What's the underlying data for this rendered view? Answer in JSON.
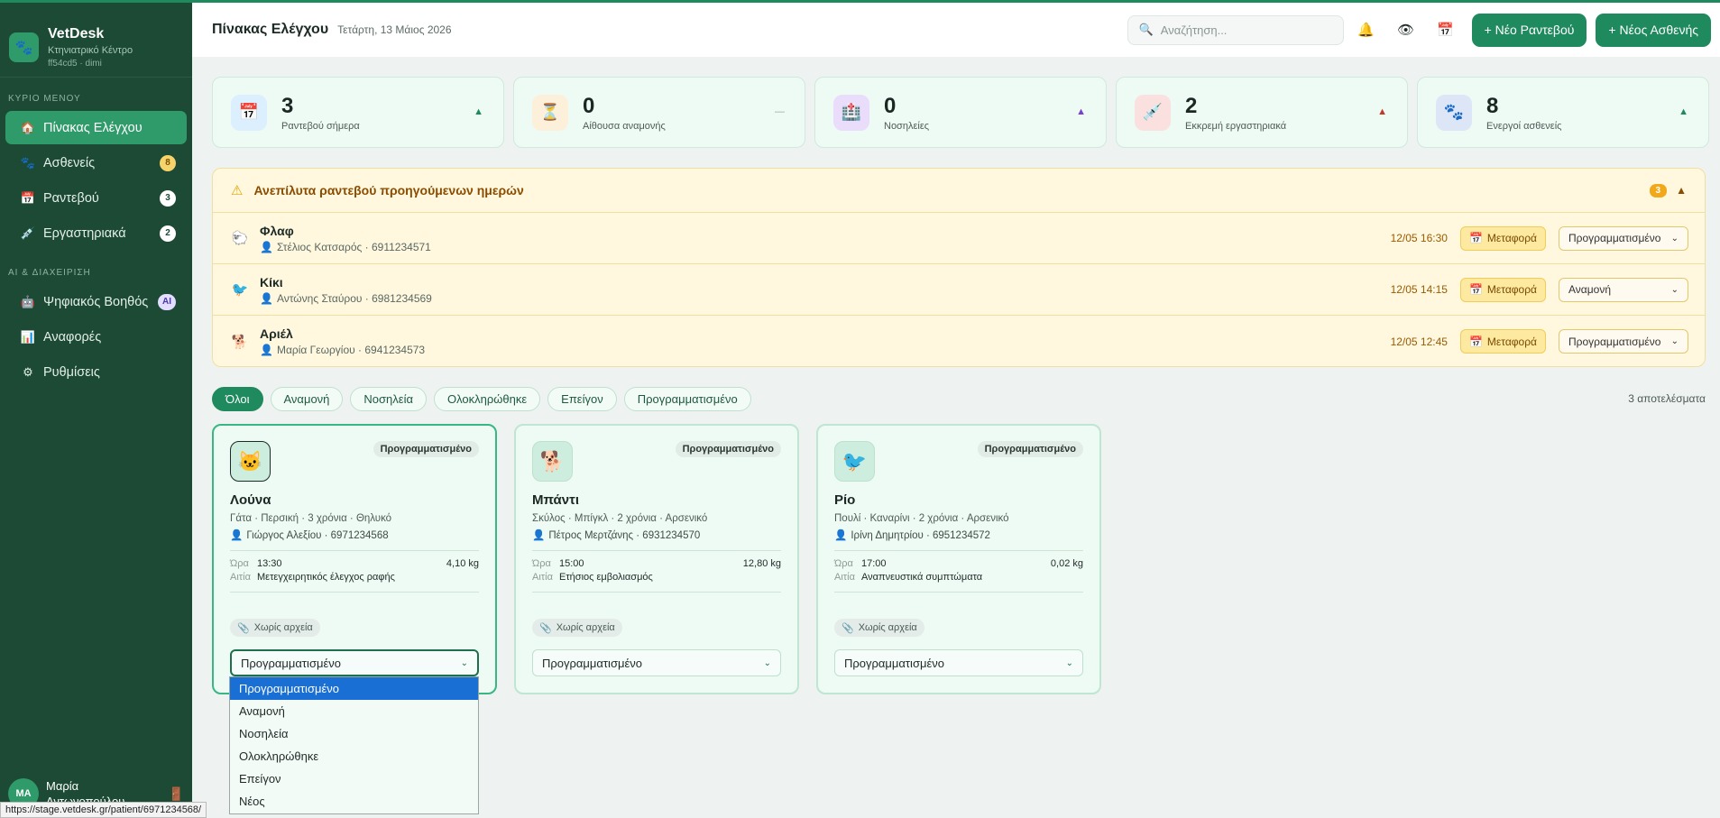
{
  "brand": {
    "name": "VetDesk",
    "subtitle": "Κτηνιατρικό Κέντρο",
    "version": "ff54cd5 · dimi"
  },
  "sidebar": {
    "section_main": "ΚΥΡΙΟ ΜΕΝΟΥ",
    "section_ai": "AI & ΔΙΑΧΕΙΡΙΣΗ",
    "items": [
      {
        "label": "Πίνακας Ελέγχου",
        "badge": ""
      },
      {
        "label": "Ασθενείς",
        "badge": "8"
      },
      {
        "label": "Ραντεβού",
        "badge": "3"
      },
      {
        "label": "Εργαστηριακά",
        "badge": "2"
      }
    ],
    "ai_items": [
      {
        "label": "Ψηφιακός Βοηθός",
        "badge": "AI"
      },
      {
        "label": "Αναφορές",
        "badge": ""
      },
      {
        "label": "Ρυθμίσεις",
        "badge": ""
      }
    ],
    "user": {
      "initials": "MA",
      "name": "Μαρία Αντωνοπούλου"
    }
  },
  "header": {
    "title": "Πίνακας Ελέγχου",
    "date": "Τετάρτη, 13 Μάιος 2026",
    "search_placeholder": "Αναζήτηση...",
    "new_appointment": "+ Νέο Ραντεβού",
    "new_patient": "+ Νέος Ασθενής"
  },
  "stats": [
    {
      "value": "3",
      "label": "Ραντεβού σήμερα",
      "icon": "calendar-icon",
      "trend": "▲",
      "color": "#1f8a5d"
    },
    {
      "value": "0",
      "label": "Αίθουσα αναμονής",
      "icon": "hourglass-icon",
      "trend": "—",
      "color": "#9aa59f"
    },
    {
      "value": "0",
      "label": "Νοσηλείες",
      "icon": "hospital-icon",
      "trend": "▲",
      "color": "#7b3fd0"
    },
    {
      "value": "2",
      "label": "Εκκρεμή εργαστηριακά",
      "icon": "syringe-icon",
      "trend": "▲",
      "color": "#c0392b"
    },
    {
      "value": "8",
      "label": "Ενεργοί ασθενείς",
      "icon": "paw-icon",
      "trend": "▲",
      "color": "#1f8a5d"
    }
  ],
  "alert": {
    "title": "Ανεπίλυτα ραντεβού προηγούμενων ημερών",
    "count": "3",
    "move_label": "Μεταφορά",
    "rows": [
      {
        "pet": "Φλαφ",
        "owner": "Στέλιος Κατσαρός · 6911234571",
        "time": "12/05 16:30",
        "status": "Προγραμματισμένο",
        "icon": "🐑"
      },
      {
        "pet": "Κίκι",
        "owner": "Αντώνης Σταύρου · 6981234569",
        "time": "12/05 14:15",
        "status": "Αναμονή",
        "icon": "🐦"
      },
      {
        "pet": "Αριέλ",
        "owner": "Μαρία Γεωργίου · 6941234573",
        "time": "12/05 12:45",
        "status": "Προγραμματισμένο",
        "icon": "🐕"
      }
    ]
  },
  "filters": [
    "Όλοι",
    "Αναμονή",
    "Νοσηλεία",
    "Ολοκληρώθηκε",
    "Επείγον",
    "Προγραμματισμένο"
  ],
  "result_count": "3 αποτελέσματα",
  "cards": [
    {
      "name": "Λούνα",
      "info": "Γάτα · Περσική · 3 χρόνια · Θηλυκό",
      "owner": "Γιώργος Αλεξίου · 6971234568",
      "time": "13:30",
      "weight": "4,10 kg",
      "reason": "Μετεγχειρητικός έλεγχος ραφής",
      "status": "Προγραμματισμένο",
      "files": "Χωρίς αρχεία",
      "icon": "🐱"
    },
    {
      "name": "Μπάντι",
      "info": "Σκύλος · Μπίγκλ · 2 χρόνια · Αρσενικό",
      "owner": "Πέτρος Μερτζάνης · 6931234570",
      "time": "15:00",
      "weight": "12,80 kg",
      "reason": "Ετήσιος εμβολιασμός",
      "status": "Προγραμματισμένο",
      "files": "Χωρίς αρχεία",
      "icon": "🐕"
    },
    {
      "name": "Ρίο",
      "info": "Πουλί · Καναρίνι · 2 χρόνια · Αρσενικό",
      "owner": "Ιρίνη Δημητρίου · 6951234572",
      "time": "17:00",
      "weight": "0,02 kg",
      "reason": "Αναπνευστικά συμπτώματα",
      "status": "Προγραμματισμένο",
      "files": "Χωρίς αρχεία",
      "icon": "🐦"
    }
  ],
  "labels": {
    "time": "Ώρα",
    "reason": "Αιτία"
  },
  "dropdown_options": [
    "Προγραμματισμένο",
    "Αναμονή",
    "Νοσηλεία",
    "Ολοκληρώθηκε",
    "Επείγον",
    "Νέος"
  ],
  "status_url": "https://stage.vetdesk.gr/patient/6971234568/"
}
